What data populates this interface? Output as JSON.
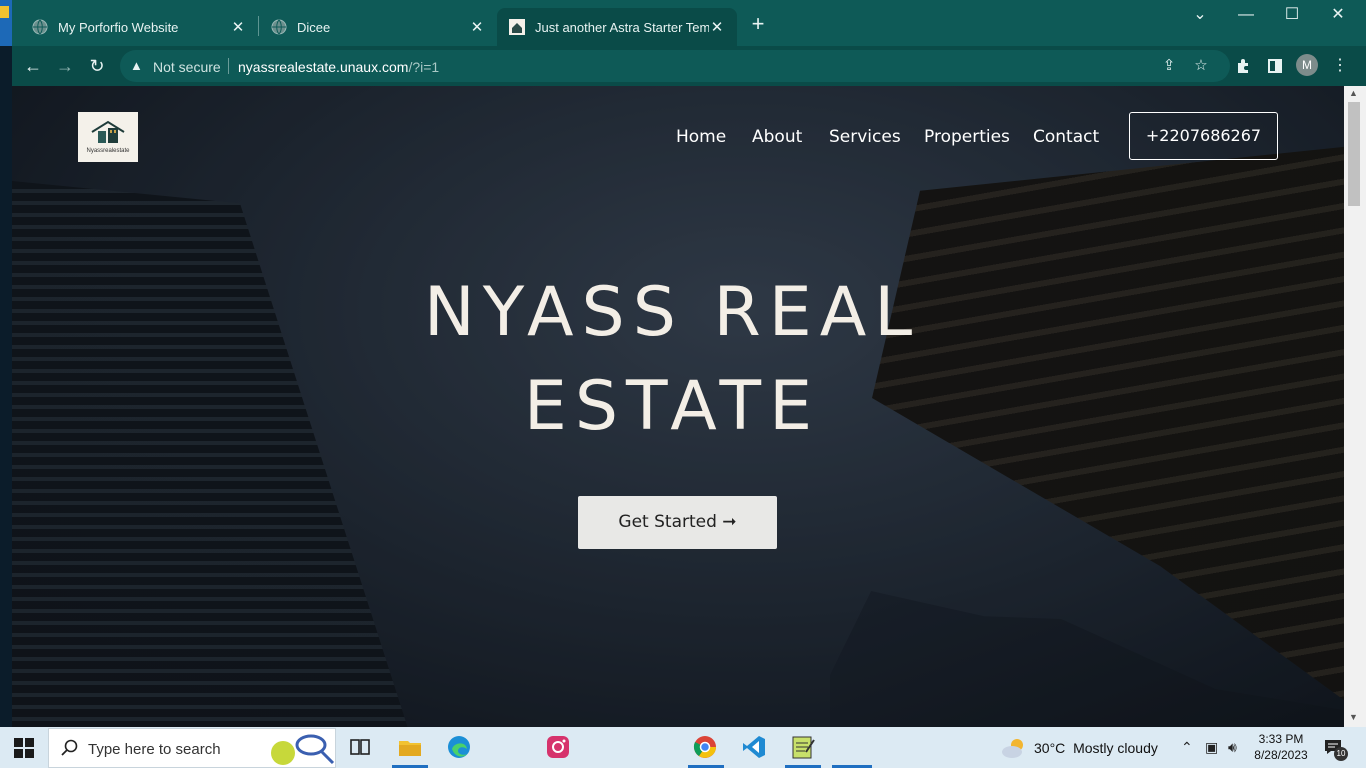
{
  "browser": {
    "tabs": [
      {
        "title": "My Porforfio Website",
        "close": "✕"
      },
      {
        "title": "Dicee",
        "close": "✕"
      },
      {
        "title": "Just another Astra Starter Templa",
        "close": "✕"
      }
    ],
    "new_tab": "+",
    "window_controls": {
      "search_tabs": "⌄",
      "minimize": "—",
      "maximize": "☐",
      "close": "✕"
    },
    "nav": {
      "back": "←",
      "forward": "→",
      "reload": "↻"
    },
    "address": {
      "security_label": "Not secure",
      "url_host": "nyassrealestate.unaux.com",
      "url_path": "/?i=1"
    },
    "profile_initial": "M",
    "icons": [
      "share-icon",
      "star-icon",
      "extensions-icon",
      "side-panel-icon",
      "menu-icon"
    ]
  },
  "site": {
    "logo_text": "Nyassrealestate",
    "nav_items": [
      "Home",
      "About",
      "Services",
      "Properties",
      "Contact"
    ],
    "phone": "+2207686267",
    "hero": {
      "title_line1": "NYASS REAL",
      "title_line2": "ESTATE",
      "cta_label": "Get Started ➞"
    }
  },
  "taskbar": {
    "search_placeholder": "Type here to search",
    "weather": {
      "temp": "30°C",
      "condition": "Mostly cloudy"
    },
    "clock": {
      "time": "3:33 PM",
      "date": "8/28/2023"
    },
    "notification_count": "10",
    "apps": [
      "task-view-icon",
      "file-explorer-icon",
      "edge-icon",
      "instagram-icon",
      "chrome-icon",
      "vscode-icon",
      "notepad-icon"
    ]
  },
  "colors": {
    "chrome_teal": "#0e5a57",
    "chrome_teal_dark": "#0a4b48",
    "hero_text": "#f3eee6",
    "cta_bg": "#e8e8e6",
    "taskbar_bg": "#dceaf3"
  }
}
